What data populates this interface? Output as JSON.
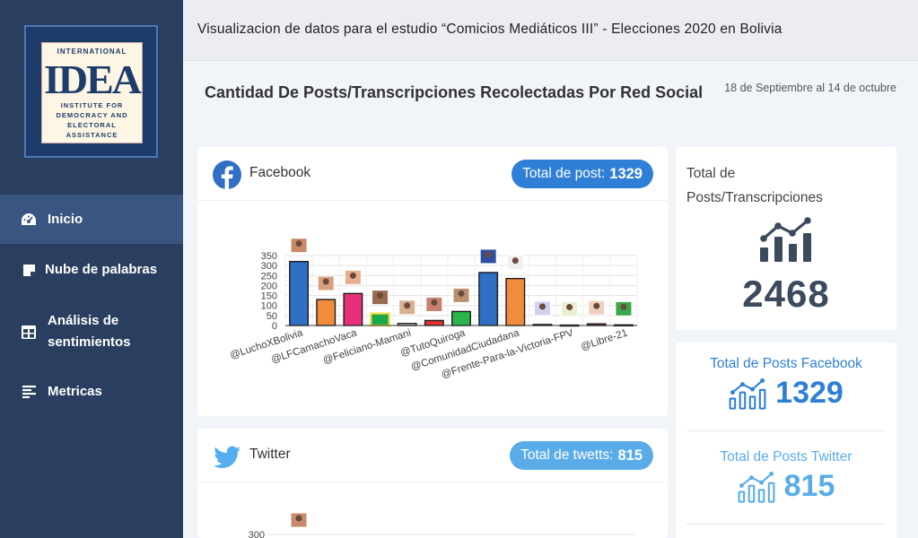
{
  "logo": {
    "top_text": "INTERNATIONAL",
    "main_text": "IDEA",
    "sub_text": "INSTITUTE FOR\nDEMOCRACY AND\nELECTORAL\nASSISTANCE"
  },
  "sidebar": {
    "items": [
      {
        "label": "Inicio",
        "icon": "gauge-icon",
        "active": true
      },
      {
        "label": "Nube de palabras",
        "icon": "sticky-note-icon",
        "active": false
      },
      {
        "label": "Análisis de sentimientos",
        "icon": "table-icon",
        "active": false
      },
      {
        "label": "Metricas",
        "icon": "align-left-icon",
        "active": false
      }
    ]
  },
  "header": {
    "title": "Visualizacion de datos para el estudio “Comicios Mediáticos III” - Elecciones 2020 en Bolivia"
  },
  "page": {
    "title": "Cantidad De Posts/Transcripciones Recolectadas Por Red Social",
    "date_range": "18 de Septiembre al 14 de octubre"
  },
  "facebook_card": {
    "name": "Facebook",
    "pill_label": "Total de post:",
    "pill_value": "1329"
  },
  "twitter_card": {
    "name": "Twitter",
    "pill_label": "Total de twetts:",
    "pill_value": "815"
  },
  "totals": {
    "label": "Total de Posts/Transcripciones",
    "value": "2468",
    "facebook_label": "Total de Posts Facebook",
    "facebook_value": "1329",
    "twitter_label": "Total de Posts Twitter",
    "twitter_value": "815"
  },
  "colors": {
    "sidebar": "#2a3f5f",
    "facebook": "#2f6fc4",
    "facebook_pill": "#2f7fd6",
    "twitter": "#55acee",
    "twitter_pill": "#5aace8"
  },
  "chart_data": [
    {
      "type": "bar",
      "categories": [
        "@LuchoXBolivia",
        "@LFCamachoVaca",
        "@Feliciano-Mamani",
        "@TutoQuiroga",
        "@ComunidadCiudadana",
        "@Frente-Para-la-Victoria-FPV",
        "@Libre-21"
      ],
      "x_tick_labels": [
        "@LuchoXBolivia",
        "@LFCamachoVaca",
        "@Feliciano-Mamani",
        "@TutoQuiroga",
        "@ComunidadCiudadana",
        "@Frente-Para-la-Victoria-FPV",
        "@Libre-21"
      ],
      "bars": [
        {
          "value": 320,
          "color": "#2f6fc4"
        },
        {
          "value": 130,
          "color": "#f08c3c"
        },
        {
          "value": 160,
          "color": "#e8307a"
        },
        {
          "value": 60,
          "color": "#1aa84a",
          "outline": "#f0e24a"
        },
        {
          "value": 10,
          "color": "#e0e0e0"
        },
        {
          "value": 25,
          "color": "#e63030"
        },
        {
          "value": 70,
          "color": "#2ab44a"
        },
        {
          "value": 265,
          "color": "#2f6fc4"
        },
        {
          "value": 235,
          "color": "#f08c3c"
        },
        {
          "value": 5,
          "color": "#7a3ea8"
        },
        {
          "value": 2,
          "color": "#2ab44a"
        },
        {
          "value": 8,
          "color": "#c8202a"
        },
        {
          "value": 3,
          "color": "#2ab44a"
        }
      ],
      "yticks": [
        0,
        50,
        100,
        150,
        200,
        250,
        300,
        350
      ],
      "ylim": [
        0,
        350
      ]
    },
    {
      "type": "bar",
      "yticks": [
        300
      ],
      "ylim": [
        0,
        300
      ]
    }
  ]
}
